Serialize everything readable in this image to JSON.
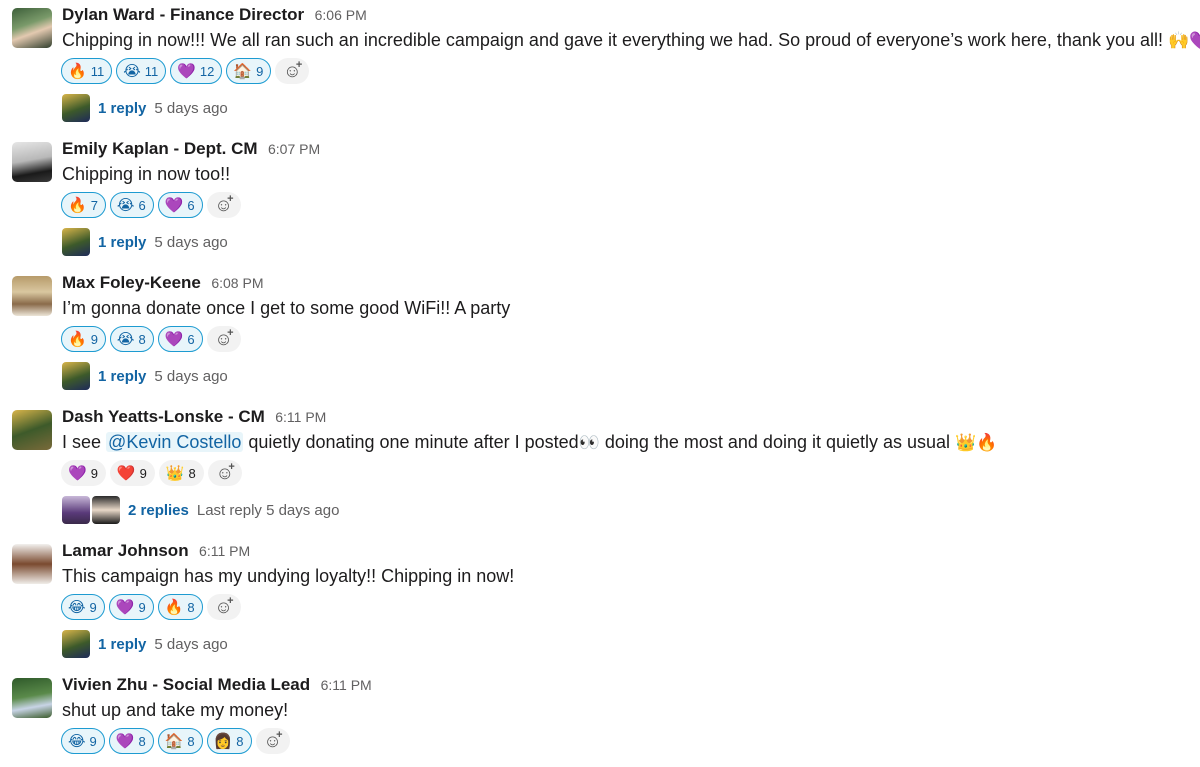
{
  "messages": [
    {
      "author": "Dylan Ward - Finance Director",
      "time": "6:06 PM",
      "text": "Chipping in now!!! We all ran such an incredible campaign and gave it everything we had. So proud of everyone’s work here, thank you all!",
      "text_emoji": "🙌💜💜",
      "reactions": [
        {
          "emoji": "🔥",
          "icon": "fire-icon",
          "count": "11"
        },
        {
          "emoji": "😭",
          "icon": "crying-face-icon",
          "count": "11"
        },
        {
          "emoji": "💜",
          "icon": "purple-heart-icon",
          "count": "12"
        },
        {
          "emoji": "🏠",
          "icon": "house-icon",
          "count": "9"
        }
      ],
      "thread": {
        "link": "1 reply",
        "meta": "5 days ago"
      }
    },
    {
      "author": "Emily Kaplan - Dept. CM",
      "time": "6:07 PM",
      "text": "Chipping in now too!!",
      "reactions": [
        {
          "emoji": "🔥",
          "icon": "fire-icon",
          "count": "7"
        },
        {
          "emoji": "😭",
          "icon": "crying-face-icon",
          "count": "6"
        },
        {
          "emoji": "💜",
          "icon": "purple-heart-icon",
          "count": "6"
        }
      ],
      "thread": {
        "link": "1 reply",
        "meta": "5 days ago"
      }
    },
    {
      "author": "Max Foley-Keene",
      "time": "6:08 PM",
      "text": "I’m gonna donate once I get to some good WiFi!! A party",
      "reactions": [
        {
          "emoji": "🔥",
          "icon": "fire-icon",
          "count": "9"
        },
        {
          "emoji": "😭",
          "icon": "crying-face-icon",
          "count": "8"
        },
        {
          "emoji": "💜",
          "icon": "purple-heart-icon",
          "count": "6"
        }
      ],
      "thread": {
        "link": "1 reply",
        "meta": "5 days ago"
      }
    },
    {
      "author": "Dash Yeatts-Lonske - CM",
      "time": "6:11 PM",
      "text_pre": "I see",
      "mention": "@Kevin Costello",
      "text_mid": "quietly donating one minute after I posted",
      "text_emoji_mid": "👀",
      "text_post": "doing the most and doing it quietly as usual",
      "text_emoji": "👑🔥",
      "reactions": [
        {
          "emoji": "💜",
          "icon": "purple-heart-icon",
          "count": "9"
        },
        {
          "emoji": "❤️",
          "icon": "red-heart-icon",
          "count": "9"
        },
        {
          "emoji": "👑",
          "icon": "crown-icon",
          "count": "8"
        }
      ],
      "thread": {
        "link": "2 replies",
        "meta": "Last reply 5 days ago"
      }
    },
    {
      "author": "Lamar Johnson",
      "time": "6:11 PM",
      "text": "This campaign has my undying loyalty!! Chipping in now!",
      "reactions": [
        {
          "emoji": "😂",
          "icon": "tears-of-joy-icon",
          "count": "9"
        },
        {
          "emoji": "💜",
          "icon": "purple-heart-icon",
          "count": "9"
        },
        {
          "emoji": "🔥",
          "icon": "fire-icon",
          "count": "8"
        }
      ],
      "thread": {
        "link": "1 reply",
        "meta": "5 days ago"
      }
    },
    {
      "author": "Vivien Zhu - Social Media Lead",
      "time": "6:11 PM",
      "text": "shut up and take my money!",
      "reactions": [
        {
          "emoji": "😂",
          "icon": "tears-of-joy-icon",
          "count": "9"
        },
        {
          "emoji": "💜",
          "icon": "purple-heart-icon",
          "count": "8"
        },
        {
          "emoji": "🏠",
          "icon": "house-icon",
          "count": "8"
        },
        {
          "emoji": "👩",
          "icon": "person-icon",
          "count": "8"
        }
      ]
    }
  ],
  "colors": {
    "link": "#1264a3",
    "reaction_border": "#1d9bd1",
    "reaction_bg": "#e8f5fa",
    "meta": "#616061"
  },
  "icons": {
    "add_reaction": "add-reaction-icon"
  }
}
